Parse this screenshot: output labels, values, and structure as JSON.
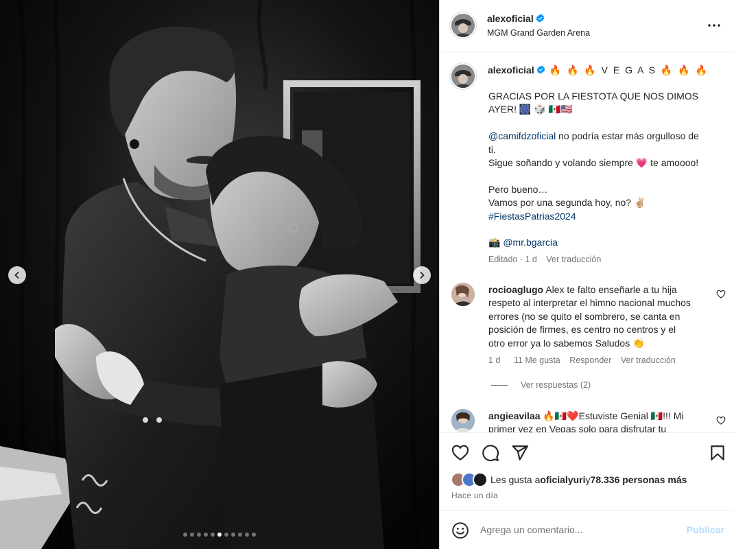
{
  "colors": {
    "verified": "#0095f6",
    "link": "#00376b",
    "muted": "#737373",
    "publish_disabled": "#b3dbff",
    "heart_emoji": "#e8336e"
  },
  "carousel": {
    "total_slides": 11,
    "active_slide": 6
  },
  "header": {
    "username": "alexoficial",
    "location": "MGM Grand Garden Arena"
  },
  "caption": {
    "username": "alexoficial",
    "headline": "🔥 🔥 🔥  V E G A S  🔥 🔥 🔥",
    "line1": "GRACIAS POR LA FIESTOTA QUE NOS DIMOS",
    "line2": "AYER! 🎆 🎲 🇲🇽🇺🇸",
    "mention": "@camifdzoficial",
    "line3_after_mention": " no podría estar más orgulloso de",
    "line4": "ti.",
    "line5_start": "Sigue soñando y volando siempre ",
    "line5_emoji": "💗",
    "line5_end": " te amoooo!",
    "line6": "Pero bueno…",
    "line7": "Vamos por una segunda hoy, no? ✌🏼",
    "hashtag": "#FiestasPatrias2024",
    "camera_emoji": "📸",
    "photo_credit": "@mr.bgarcia",
    "meta_edited": "Editado · 1 d",
    "meta_translate": "Ver traducción"
  },
  "comments": [
    {
      "username": "rocioaglugo",
      "lines": [
        " Alex te falto enseñarle a tu hija",
        "respeto al interpretar el himno nacional muchos",
        "errores (no se quito el sombrero, se canta en",
        "posición de firmes, es centro no centros y el",
        "otro error ya lo sabemos Saludos 👏"
      ],
      "time": "1 d",
      "likes": "11 Me gusta",
      "reply": "Responder",
      "translate": "Ver traducción",
      "view_replies": "Ver respuestas (2)"
    },
    {
      "username": "angieavilaa",
      "lines": [
        " 🔥🇲🇽❤️Estuviste Genial 🇲🇽!!! Mi",
        "primer vez en Vegas solo para disfrutar tu"
      ]
    }
  ],
  "likes": {
    "prefix": "Les gusta a ",
    "user": "oficialyuri",
    "middle": " y ",
    "count": "78.336 personas más"
  },
  "timestamp": "Hace un día",
  "comment_box": {
    "placeholder": "Agrega un comentario...",
    "publish": "Publicar"
  },
  "icons": [
    "chevron-left-icon",
    "chevron-right-icon",
    "more-icon",
    "verified-badge-icon",
    "heart-icon",
    "comment-icon",
    "share-icon",
    "bookmark-icon",
    "emoji-icon"
  ]
}
